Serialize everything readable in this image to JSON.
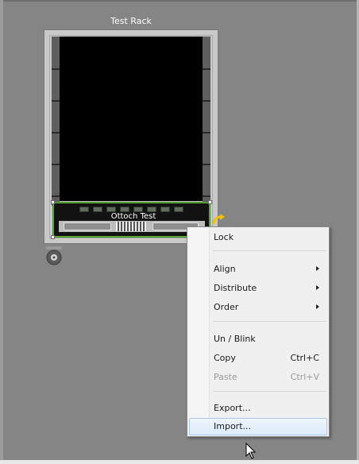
{
  "rack": {
    "title": "Test Rack",
    "device": {
      "label": "Ottoch Test",
      "led_count": 8
    }
  },
  "context_menu": {
    "items": [
      {
        "label": "Lock",
        "shortcut": "",
        "submenu": false,
        "disabled": false
      },
      {
        "label": "Align",
        "shortcut": "",
        "submenu": true,
        "disabled": false
      },
      {
        "label": "Distribute",
        "shortcut": "",
        "submenu": true,
        "disabled": false
      },
      {
        "label": "Order",
        "shortcut": "",
        "submenu": true,
        "disabled": false
      },
      {
        "label": "Un / Blink",
        "shortcut": "",
        "submenu": false,
        "disabled": false
      },
      {
        "label": "Copy",
        "shortcut": "Ctrl+C",
        "submenu": false,
        "disabled": false
      },
      {
        "label": "Paste",
        "shortcut": "Ctrl+V",
        "submenu": false,
        "disabled": true
      },
      {
        "label": "Export...",
        "shortcut": "",
        "submenu": false,
        "disabled": false
      },
      {
        "label": "Import...",
        "shortcut": "",
        "submenu": false,
        "disabled": false,
        "hovered": true
      }
    ]
  },
  "icons": {
    "wheel": "caster-wheel-icon",
    "rotate": "rotate-arrow-icon",
    "submenu": "chevron-right-icon",
    "cursor": "mouse-pointer-icon"
  },
  "colors": {
    "canvas": "#858585",
    "rack_interior": "#000000",
    "selection": "#6cb33c",
    "menu_bg": "#f0f0f0",
    "menu_hover": "#dcebfb",
    "rotate_arrow": "#f2c200"
  }
}
